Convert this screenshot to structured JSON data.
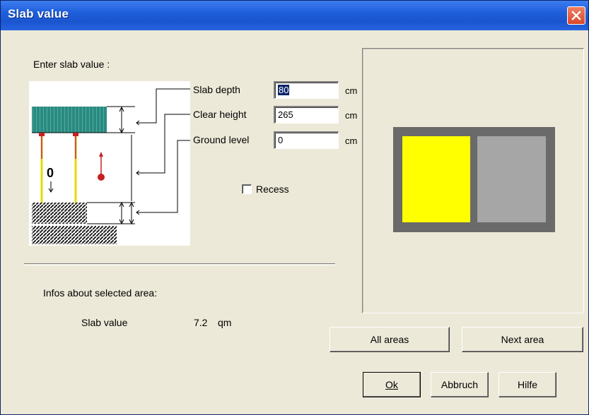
{
  "window": {
    "title": "Slab value"
  },
  "form": {
    "heading": "Enter slab value :",
    "fields": [
      {
        "label": "Slab depth",
        "value": "80",
        "unit": "cm"
      },
      {
        "label": "Clear height",
        "value": "265",
        "unit": "cm"
      },
      {
        "label": "Ground level",
        "value": "0",
        "unit": "cm"
      }
    ],
    "recess": {
      "label": "Recess",
      "checked": false
    },
    "diagram_marker": "0"
  },
  "info": {
    "heading": "Infos about selected area:",
    "slab_label": "Slab value",
    "slab_value": "7.2",
    "slab_unit": "qm"
  },
  "preview": {
    "room_colors": [
      "#ffff00",
      "#a6a6a6"
    ],
    "frame_color": "#6a6a6a"
  },
  "buttons": {
    "all_areas": "All areas",
    "next_area": "Next area",
    "ok": "Ok",
    "cancel": "Abbruch",
    "help": "Hilfe"
  },
  "colors": {
    "title_bar": "#1f5fdb",
    "slab_fill": "#2a8a80"
  }
}
